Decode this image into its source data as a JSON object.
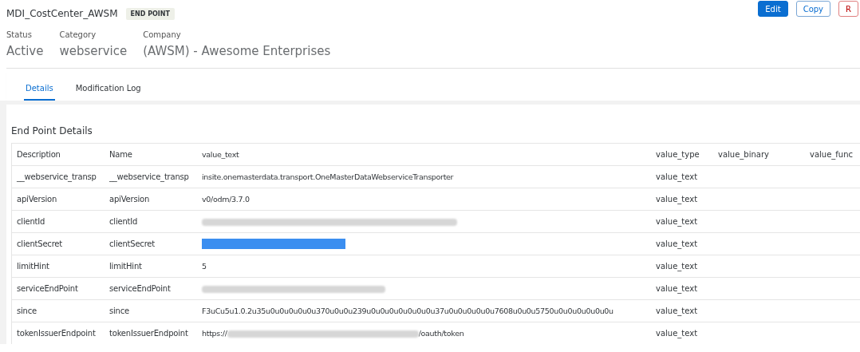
{
  "header": {
    "title": "MDI_CostCenter_AWSM",
    "badge": "END POINT",
    "actions": [
      {
        "label": "Edit",
        "kind": "primary"
      },
      {
        "label": "Copy",
        "kind": "secondary"
      },
      {
        "label": "R",
        "kind": "danger"
      }
    ]
  },
  "attributes": [
    {
      "label": "Status",
      "value": "Active"
    },
    {
      "label": "Category",
      "value": "webservice"
    },
    {
      "label": "Company",
      "value": "(AWSM) - Awesome Enterprises"
    }
  ],
  "tabs": [
    {
      "label": "Details",
      "selected": true
    },
    {
      "label": "Modification Log",
      "selected": false
    }
  ],
  "section": {
    "title": "End Point Details",
    "columns": [
      "Description",
      "Name",
      "value_text",
      "value_type",
      "value_binary",
      "value_func"
    ],
    "rows": [
      {
        "description": "__webservice_transp",
        "name": "__webservice_transp",
        "value": [
          {
            "kind": "text",
            "text": "insite.onemasterdata.transport.OneMasterDataWebserviceTransporter"
          }
        ],
        "value_type": "value_text"
      },
      {
        "description": "apiVersion",
        "name": "apiVersion",
        "value": [
          {
            "kind": "text",
            "text": "v0/odm/3.7.0"
          }
        ],
        "value_type": "value_text"
      },
      {
        "description": "clientId",
        "name": "clientId",
        "value": [
          {
            "kind": "redacted",
            "selected": false
          }
        ],
        "value_type": "value_text"
      },
      {
        "description": "clientSecret",
        "name": "clientSecret",
        "value": [
          {
            "kind": "redacted",
            "selected": true
          }
        ],
        "value_type": "value_text"
      },
      {
        "description": "limitHint",
        "name": "limitHint",
        "value": [
          {
            "kind": "text",
            "text": "5"
          }
        ],
        "value_type": "value_text"
      },
      {
        "description": "serviceEndPoint",
        "name": "serviceEndPoint",
        "value": [
          {
            "kind": "redacted",
            "selected": false
          }
        ],
        "value_type": "value_text"
      },
      {
        "description": "since",
        "name": "since",
        "value": [
          {
            "kind": "text",
            "text": "F3uCu5u1.0.2u35u0u0u0u0u0u370u0u0u239u0u0u0u0u0u0u0u37u0u0u0u0u0u7608u0u0u5750u0u0u0u0u0u0u"
          }
        ],
        "value_type": "value_text"
      },
      {
        "description": "tokenIssuerEndpoint",
        "name": "tokenIssuerEndpoint",
        "value": [
          {
            "kind": "text",
            "text": "https://"
          },
          {
            "kind": "redacted",
            "selected": false
          },
          {
            "kind": "text",
            "text": "/oauth/token"
          }
        ],
        "value_type": "value_text"
      }
    ]
  }
}
